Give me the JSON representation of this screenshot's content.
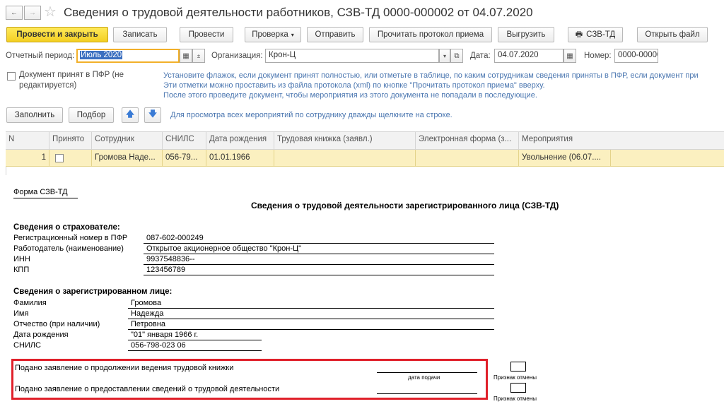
{
  "window": {
    "title": "Сведения о трудовой деятельности работников, СЗВ-ТД 0000-000002 от 04.07.2020",
    "back_arrow": "←",
    "forward_arrow": "→",
    "star": "☆"
  },
  "toolbar": {
    "post_close": "Провести и закрыть",
    "save": "Записать",
    "post": "Провести",
    "check": "Проверка",
    "send": "Отправить",
    "read_protocol": "Прочитать протокол приема",
    "upload": "Выгрузить",
    "szv_td": "СЗВ-ТД",
    "open_file": "Открыть файл"
  },
  "form": {
    "period_label": "Отчетный период:",
    "period_value": "Июль 2020",
    "org_label": "Организация:",
    "org_value": "Крон-Ц",
    "date_label": "Дата:",
    "date_value": "04.07.2020",
    "number_label": "Номер:",
    "number_value": "0000-00000",
    "accepted_label_1": "Документ принят в ПФР (не",
    "accepted_label_2": "редактируется)",
    "hint_1": "Установите флажок, если документ принят полностью, или отметьте в таблице, по каким сотрудникам сведения приняты в ПФР, если документ при",
    "hint_2": "Эти отметки можно проставить из файла протокола (xml) по кнопке \"Прочитать протокол приема\" вверху.",
    "hint_3": "После этого проведите документ, чтобы мероприятия из этого документа не попадали в последующие."
  },
  "table_toolbar": {
    "fill": "Заполнить",
    "select": "Подбор",
    "hint": "Для просмотра всех мероприятий по сотруднику дважды щелкните на строке."
  },
  "table": {
    "headers": [
      "N",
      "Принято",
      "Сотрудник",
      "СНИЛС",
      "Дата рождения",
      "Трудовая книжка (заявл.)",
      "Электронная форма (з...",
      "Мероприятия"
    ],
    "row": {
      "n": "1",
      "employee": "Громова Наде...",
      "snils": "056-79...",
      "birth": "01.01.1966",
      "events": "Увольнение (06.07...."
    }
  },
  "printform": {
    "form_name": "Форма СЗВ-ТД",
    "title": "Сведения о трудовой деятельности зарегистрированного лица (СЗВ-ТД)",
    "insurer_header": "Сведения о страхователе:",
    "reg_num_label": "Регистрационный номер в ПФР",
    "reg_num_value": "087-602-000249",
    "employer_label": "Работодатель (наименование)",
    "employer_value": "Открытое акционерное общество \"Крон-Ц\"",
    "inn_label": "ИНН",
    "inn_value": "9937548836--",
    "kpp_label": "КПП",
    "kpp_value": "123456789",
    "person_header": "Сведения о зарегистрированном лице:",
    "surname_label": "Фамилия",
    "surname_value": "Громова",
    "name_label": "Имя",
    "name_value": "Надежда",
    "patronymic_label": "Отчество (при наличии)",
    "patronymic_value": "Петровна",
    "birthdate_label": "Дата рождения",
    "birthdate_value": "\"01\" января 1966 г.",
    "snils_label": "СНИЛС",
    "snils_value": "056-798-023 06",
    "statement_1": "Подано заявление о продолжении ведения трудовой книжки",
    "statement_2": "Подано заявление о предоставлении сведений о трудовой деятельности",
    "date_submitted": "дата подачи",
    "cancel_sign_1": "Признак отмены",
    "cancel_sign_2": "Признак отмены"
  },
  "colors": {
    "primary_button": "#f3cf22",
    "selected_row": "#fbf0c0",
    "highlight_frame": "#e0202a",
    "hint_text": "#4a76b0"
  }
}
